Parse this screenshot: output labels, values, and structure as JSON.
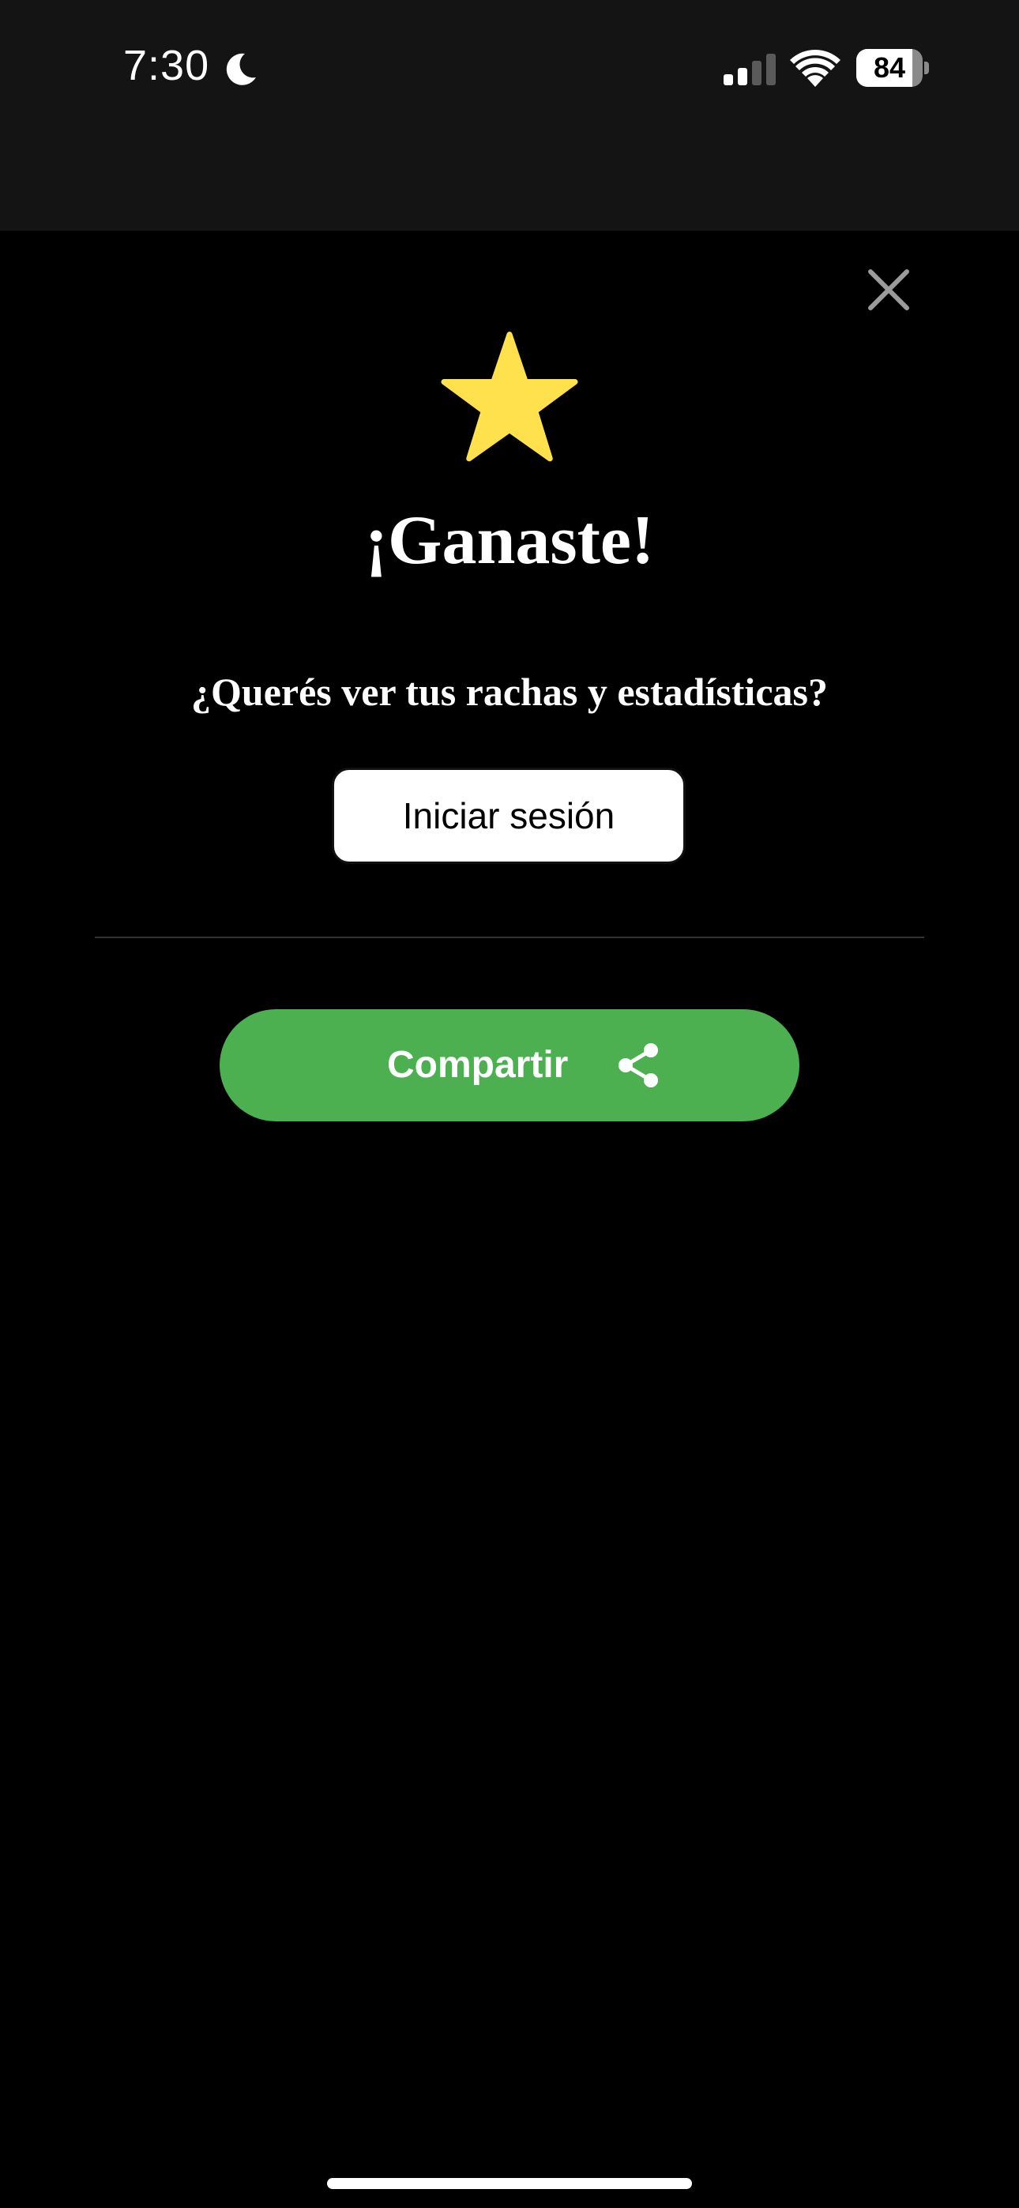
{
  "status_bar": {
    "time": "7:30",
    "battery_level": "84",
    "battery_fraction": 0.84,
    "icons": [
      "moon-icon",
      "cellular-signal-icon",
      "wifi-icon",
      "battery-icon"
    ]
  },
  "modal": {
    "close_icon": "close-icon",
    "star_icon": "star-icon",
    "title": "¡Ganaste!",
    "subtitle": "¿Querés ver tus rachas y estadísticas?",
    "login_label": "Iniciar sesión",
    "share_label": "Compartir",
    "share_icon": "share-icon"
  },
  "colors": {
    "background": "#000000",
    "status_bar_background": "#141414",
    "star": "#ffe14d",
    "share_button": "#4caf50",
    "close_icon": "#9b9b9b"
  }
}
